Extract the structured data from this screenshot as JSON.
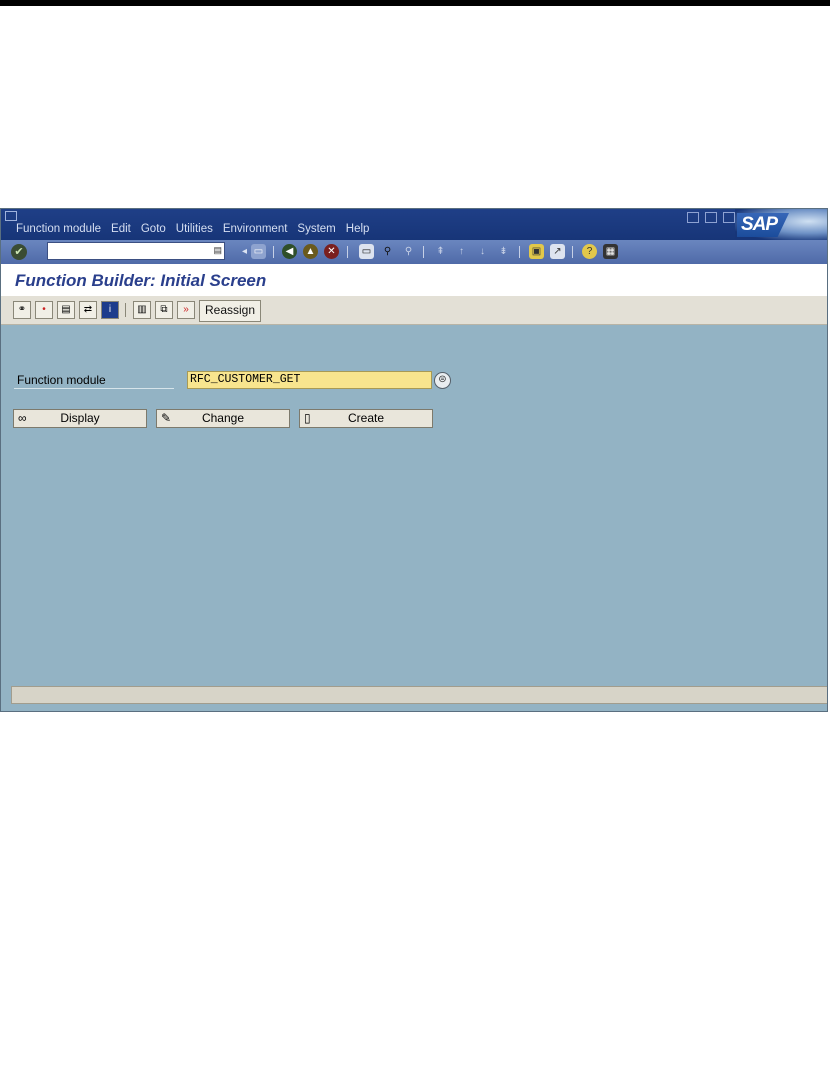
{
  "menubar": {
    "items": [
      "Function module",
      "Edit",
      "Goto",
      "Utilities",
      "Environment",
      "System",
      "Help"
    ],
    "logo_text": "SAP"
  },
  "toolbar": {
    "command_field_value": "",
    "icons": [
      "enter-icon",
      "back-icon",
      "exit-icon",
      "cancel-icon",
      "print-icon",
      "find-icon",
      "find-next-icon",
      "first-page-icon",
      "previous-page-icon",
      "next-page-icon",
      "last-page-icon",
      "create-session-icon",
      "shortcut-icon",
      "help-icon",
      "layout-menu-icon"
    ]
  },
  "title": "Function Builder: Initial Screen",
  "app_toolbar": {
    "reassign_label": "Reassign",
    "icons": [
      "where-used-icon",
      "check-icon",
      "activate-icon",
      "test-icon",
      "info-icon",
      "delete-icon",
      "copy-icon",
      "rename-icon"
    ]
  },
  "form": {
    "function_module_label": "Function module",
    "function_module_value": "RFC_CUSTOMER_GET"
  },
  "buttons": {
    "display": "Display",
    "change": "Change",
    "create": "Create"
  }
}
